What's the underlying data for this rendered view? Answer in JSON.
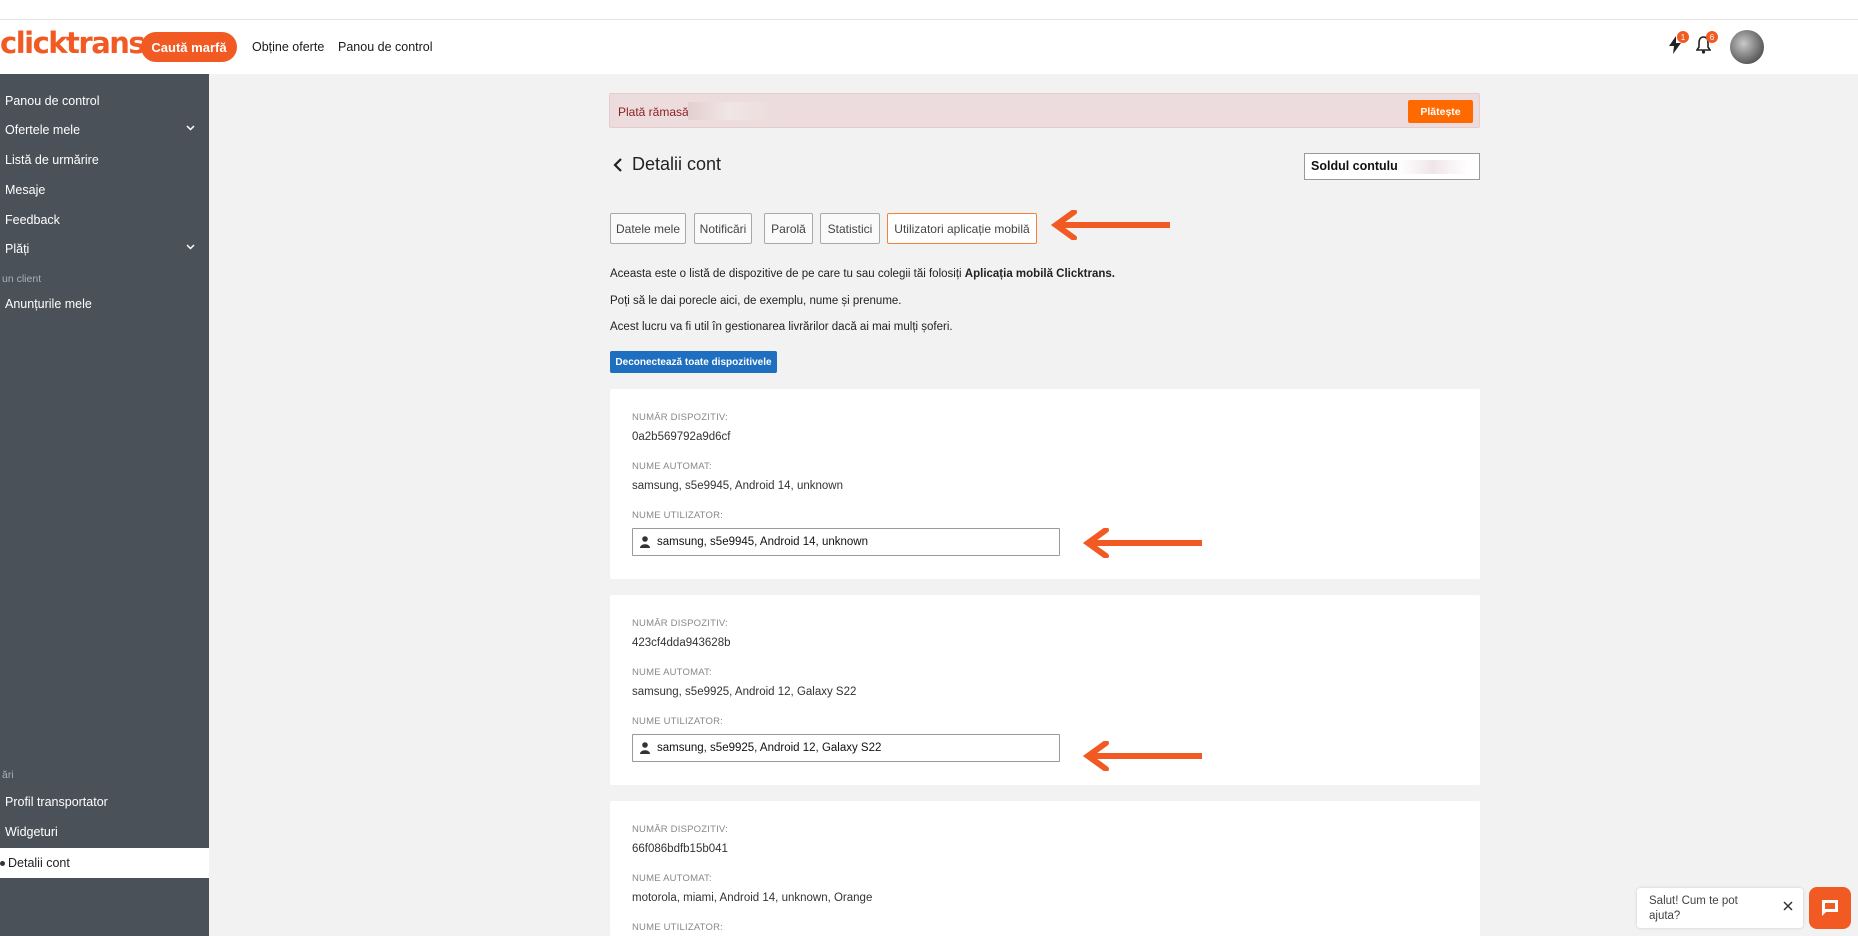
{
  "header": {
    "logo": "clicktrans",
    "search_cargo_label": "Caută marfă",
    "nav_links": [
      "Obține oferte",
      "Panou de control"
    ],
    "lightning_badge": "1",
    "bell_badge": "6"
  },
  "sidebar": {
    "items": [
      {
        "label": "Panou de control"
      },
      {
        "label": "Ofertele mele",
        "chevron": true
      },
      {
        "label": "Listă de urmărire"
      },
      {
        "label": "Mesaje"
      },
      {
        "label": "Feedback"
      },
      {
        "label": "Plăți",
        "chevron": true
      }
    ],
    "section_client": "un client",
    "client_items": [
      {
        "label": "Anunțurile mele"
      }
    ],
    "section_settings": "ări",
    "settings_items": [
      {
        "label": "Profil transportator"
      },
      {
        "label": "Widgeturi"
      }
    ],
    "active_item": "Detalii cont"
  },
  "alert": {
    "text": "Plată rămasă:",
    "pay_label": "Plătește"
  },
  "page": {
    "title": "Detalii cont",
    "balance_label": "Soldul contului -"
  },
  "tabs": [
    {
      "label": "Datele mele"
    },
    {
      "label": "Notificări"
    },
    {
      "label": "Parolă"
    },
    {
      "label": "Statistici"
    },
    {
      "label": "Utilizatori aplicație mobilă",
      "active": true
    }
  ],
  "description": {
    "line1_prefix": "Aceasta este o listă de dispozitive de pe care tu sau colegii tăi folosiți ",
    "line1_bold": "Aplicația mobilă Clicktrans.",
    "line2": "Poți să le dai porecle aici, de exemplu, nume și prenume.",
    "line3": "Acest lucru va fi util în gestionarea livrărilor dacă ai mai mulți șoferi."
  },
  "disconnect_label": "Deconectează toate dispozitivele",
  "field_labels": {
    "device_number": "NUMĂR DISPOZITIV:",
    "auto_name": "NUME AUTOMAT:",
    "user_name": "NUME UTILIZATOR:"
  },
  "devices": [
    {
      "number": "0a2b569792a9d6cf",
      "auto_name": "samsung, s5e9945, Android 14, unknown",
      "user_name": "samsung, s5e9945, Android 14, unknown"
    },
    {
      "number": "423cf4dda943628b",
      "auto_name": "samsung, s5e9925, Android 12, Galaxy S22",
      "user_name": "samsung, s5e9925, Android 12, Galaxy S22"
    },
    {
      "number": "66f086bdfb15b041",
      "auto_name": "motorola, miami, Android 14, unknown, Orange",
      "user_name": ""
    }
  ],
  "chat": {
    "text": "Salut! Cum te pot ajuta?"
  },
  "colors": {
    "brand_orange": "#f15a22",
    "sidebar_bg": "#4a5159",
    "button_blue": "#1e6fbf",
    "alert_bg": "#ecdcdd"
  }
}
